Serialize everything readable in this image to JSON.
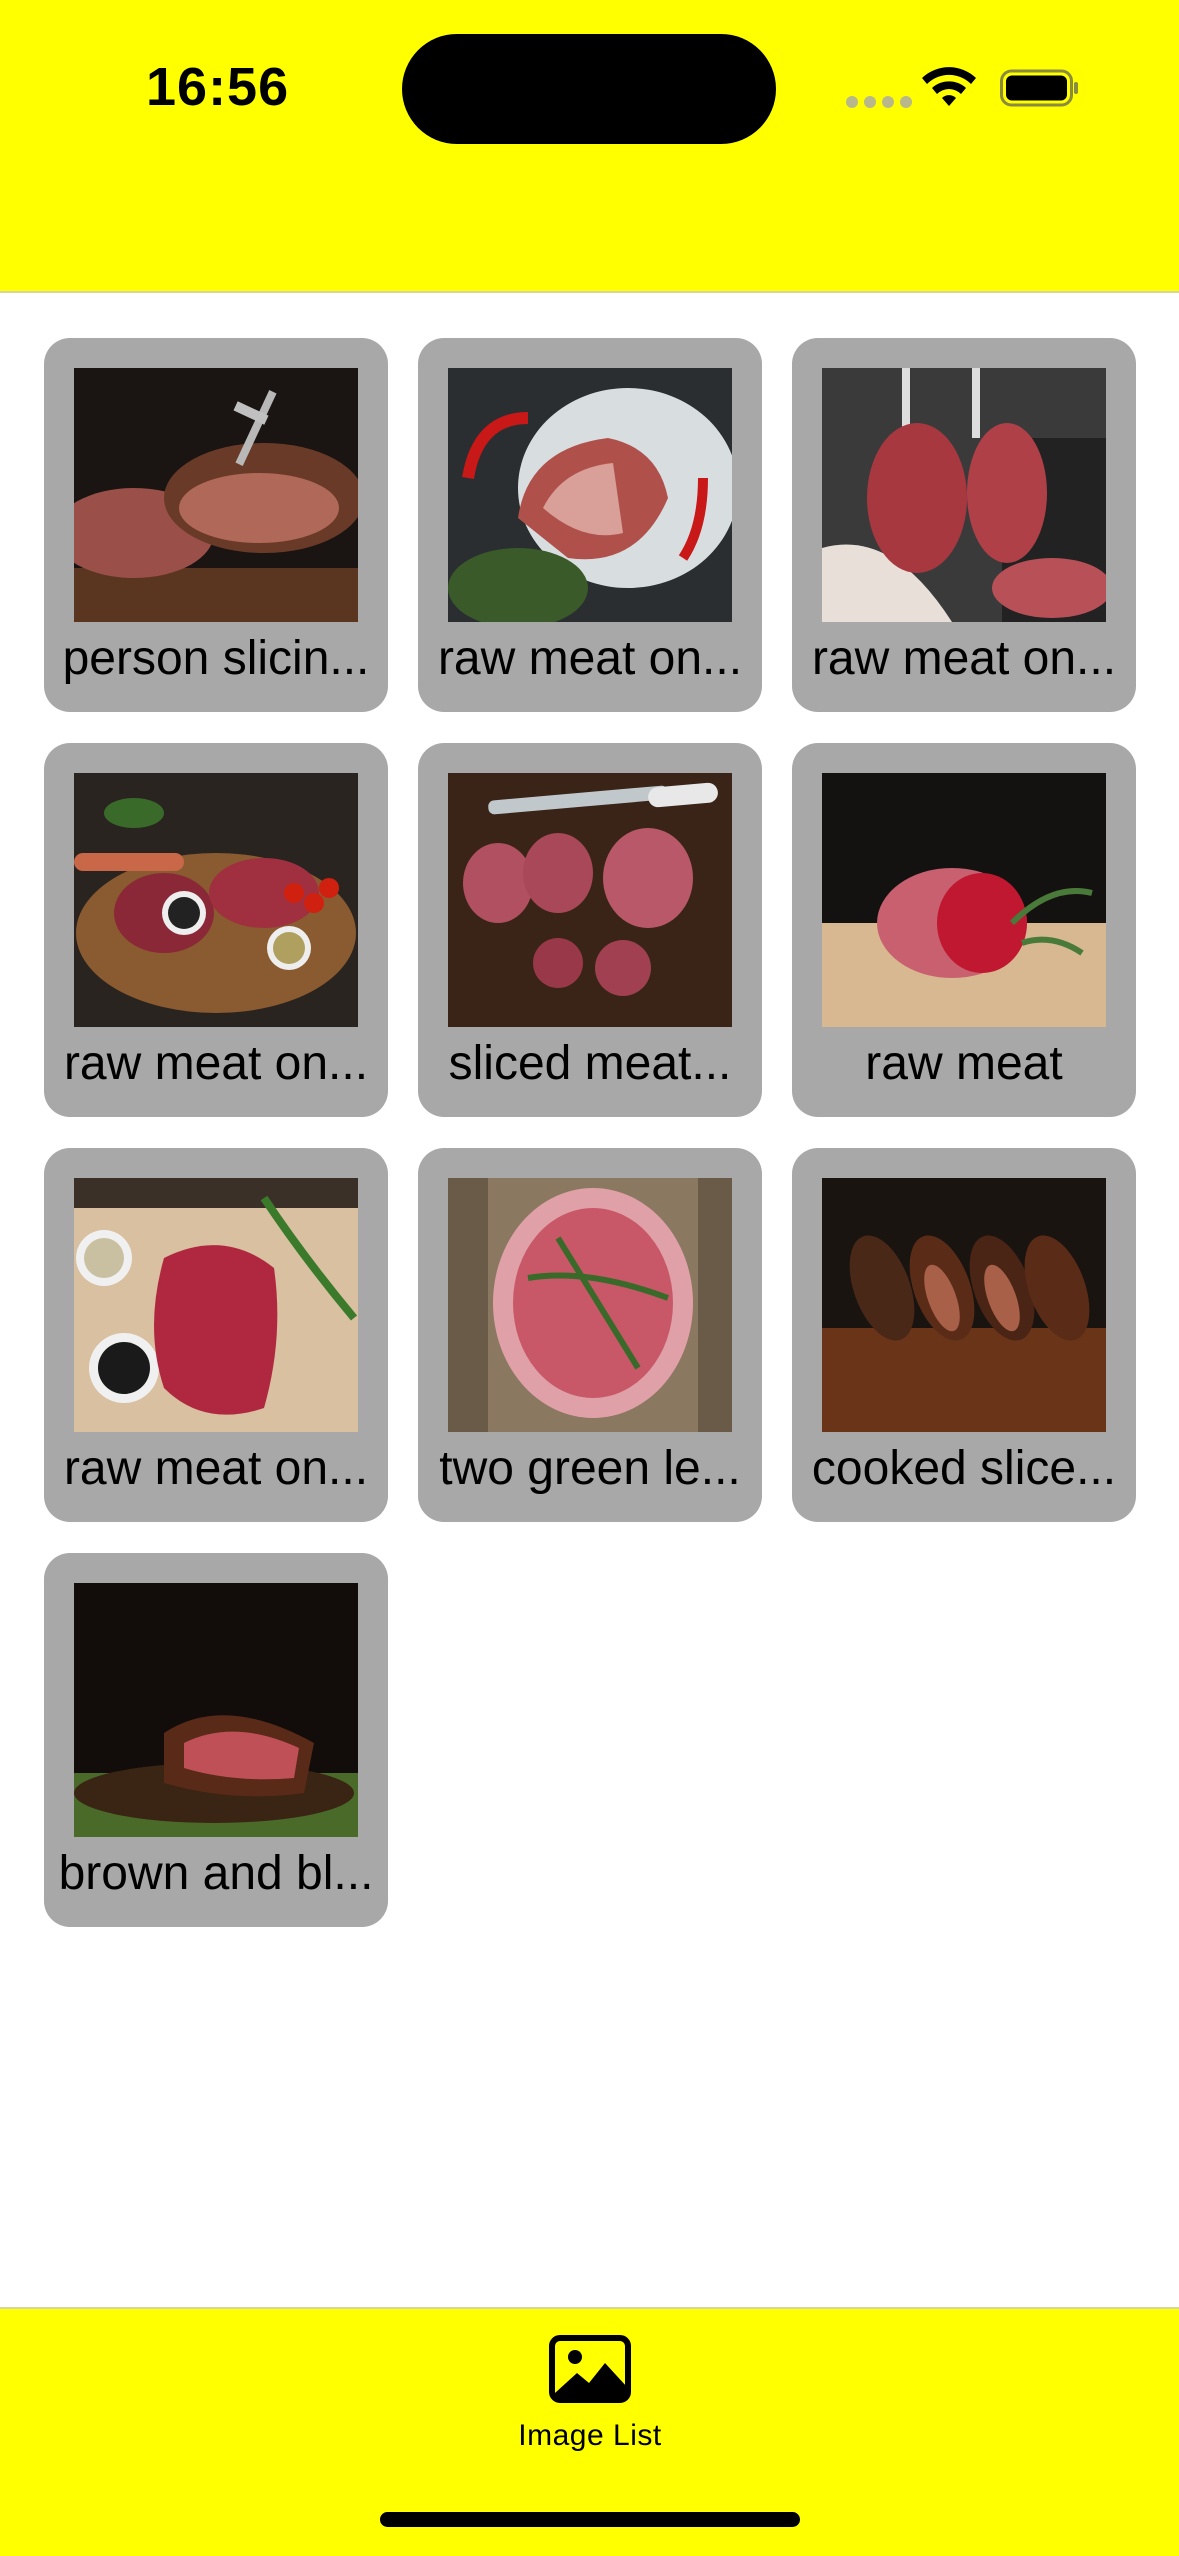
{
  "status_bar": {
    "time": "16:56",
    "icons": [
      "signal-dots-icon",
      "wifi-icon",
      "battery-icon"
    ]
  },
  "colors": {
    "bar_background": "#ffff00",
    "card_background": "#a8a8a8",
    "page_background": "#ffffff"
  },
  "images": [
    {
      "caption": "person slicin...",
      "theme": "steak-slicing-fork"
    },
    {
      "caption": "raw meat on...",
      "theme": "tbone-on-ice"
    },
    {
      "caption": "raw meat on...",
      "theme": "hanging-tomahawk"
    },
    {
      "caption": "raw meat on...",
      "theme": "meat-platter"
    },
    {
      "caption": "sliced meat...",
      "theme": "meat-with-knife"
    },
    {
      "caption": "raw meat",
      "theme": "raw-roast"
    },
    {
      "caption": "raw meat on...",
      "theme": "steak-with-peppercorns"
    },
    {
      "caption": "two green le...",
      "theme": "ribeye-rosemary"
    },
    {
      "caption": "cooked slice...",
      "theme": "cooked-slices"
    },
    {
      "caption": "brown and bl...",
      "theme": "seared-steak"
    }
  ],
  "tab_bar": {
    "tabs": [
      {
        "label": "Image List",
        "icon": "photo-icon"
      }
    ]
  }
}
